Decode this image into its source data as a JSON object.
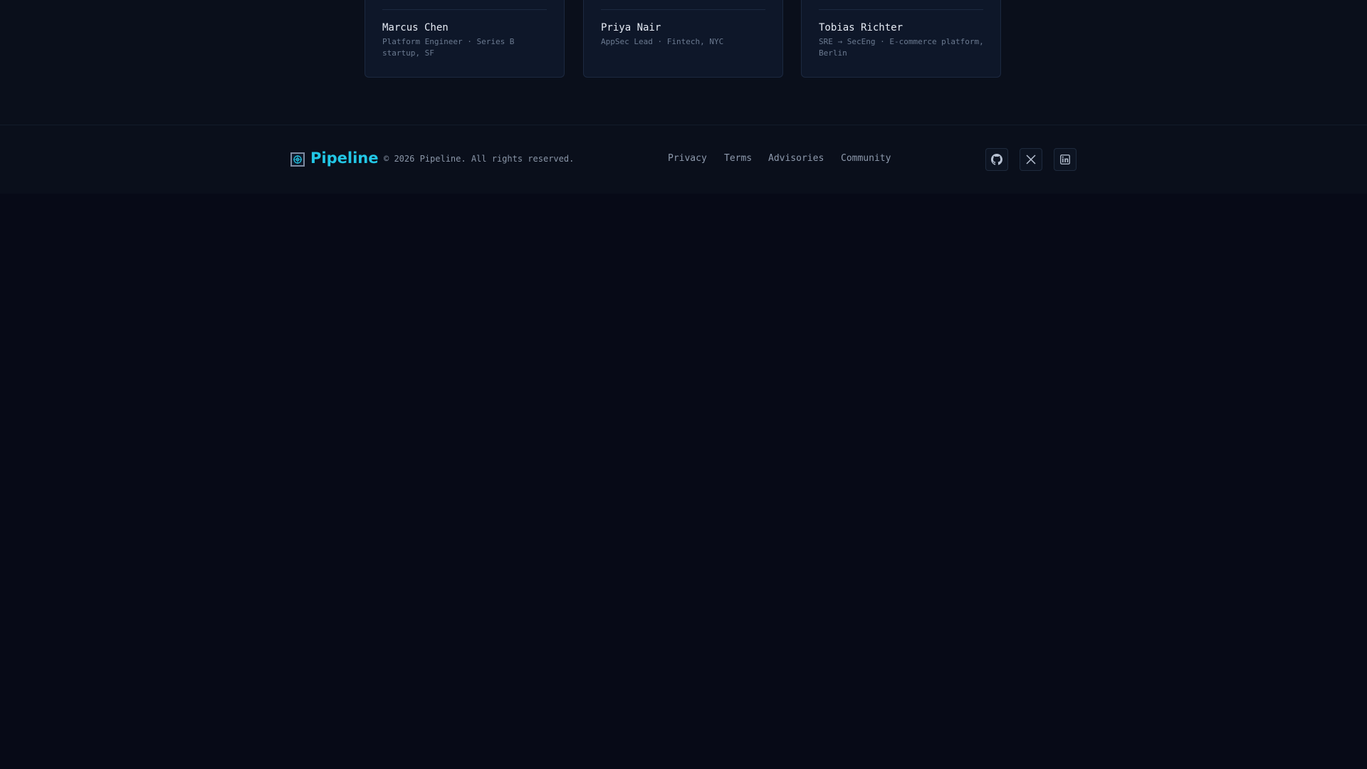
{
  "testimonials": [
    {
      "name": "Marcus Chen",
      "role": "Platform Engineer · Series B\nstartup, SF"
    },
    {
      "name": "Priya Nair",
      "role": "AppSec Lead · Fintech, NYC"
    },
    {
      "name": "Tobias Richter",
      "role": "SRE → SecEng · E-commerce platform,\nBerlin"
    }
  ],
  "footer": {
    "brand": "Pipeline",
    "copyright": "© 2026 Pipeline. All rights reserved.",
    "links": [
      "Privacy",
      "Terms",
      "Advisories",
      "Community"
    ],
    "social": [
      "github-icon",
      "x-icon",
      "linkedin-icon"
    ]
  },
  "colors": {
    "page_background": "#070a17",
    "card_background": "#0e1729",
    "brand_accent": "#22c7e6",
    "muted_text": "#6b7a90"
  }
}
